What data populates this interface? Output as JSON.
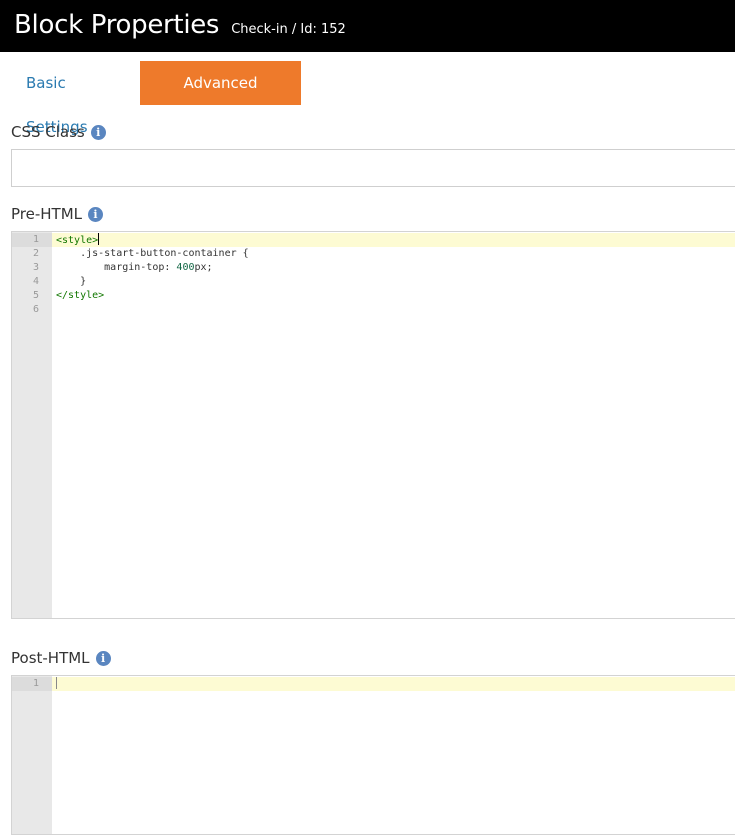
{
  "header": {
    "title": "Block Properties",
    "subtitle": "Check-in / Id: 152"
  },
  "tabs": [
    {
      "label": "Basic Settings",
      "active": false
    },
    {
      "label": "Advanced Settings",
      "active": true
    }
  ],
  "css_class": {
    "label": "CSS Class",
    "value": "",
    "info_icon": "info-icon"
  },
  "pre_html": {
    "label": "Pre-HTML",
    "info_icon": "info-icon",
    "line_numbers": [
      "1",
      "2",
      "3",
      "4",
      "5",
      "6"
    ],
    "lines": [
      "<style>",
      "    .js-start-button-container {",
      "        margin-top: 400px;",
      "    }",
      "</style>",
      ""
    ]
  },
  "post_html": {
    "label": "Post-HTML",
    "info_icon": "info-icon",
    "line_numbers": [
      "1"
    ],
    "lines": [
      ""
    ]
  },
  "colors": {
    "header_bg": "#000000",
    "tab_active_bg": "#ee7a2b",
    "tab_link": "#2a7ab0",
    "info_icon": "#5a86c0",
    "active_line": "#fdfbd3",
    "gutter": "#e8e8e8",
    "code_tag": "#117700",
    "code_number": "#116644"
  }
}
